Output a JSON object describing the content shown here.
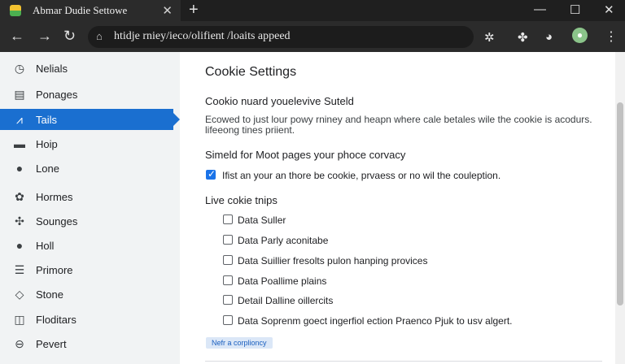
{
  "window": {
    "tab_title": "Abmar Dudie Settowe",
    "tab_close": "✕",
    "new_tab": "+",
    "minimize": "—",
    "maximize": "☐",
    "close": "✕"
  },
  "toolbar": {
    "back": "←",
    "forward": "→",
    "reload": "↻",
    "url": "htidje rniey/ieco/olifient /loaits appeed",
    "site_icon": "home-icon",
    "ext1": "✲",
    "ext2": "✤",
    "ext3": "◕",
    "avatar": "●",
    "menu": "⋮"
  },
  "sidebar": {
    "items": [
      {
        "label": "Nelials",
        "icon": "◷"
      },
      {
        "label": "Ponages",
        "icon": "▤"
      },
      {
        "label": "Tails",
        "icon": "⩘"
      },
      {
        "label": "Hoip",
        "icon": "▬"
      },
      {
        "label": "Lone",
        "icon": "●"
      },
      {
        "label": "Hormes",
        "icon": "✿"
      },
      {
        "label": "Sounges",
        "icon": "✣"
      },
      {
        "label": "Holl",
        "icon": "●"
      },
      {
        "label": "Primore",
        "icon": "☰"
      },
      {
        "label": "Stone",
        "icon": "◇"
      },
      {
        "label": "Floditars",
        "icon": "◫"
      },
      {
        "label": "Pevert",
        "icon": "⊖"
      }
    ],
    "active_index": 2
  },
  "main": {
    "title": "Cookie Settings",
    "section1_heading": "Cookio nuard youelevive Suteld",
    "section1_para": "Ecowed to just lour powy rniney and heapn where cale betales wile the cookie is acodurs. lifeeong tines priient.",
    "section2_heading": "Simeld for Moot pages your phoce corvacy",
    "main_checkbox_label": "Ifist an your an thore be cookie, prvaess or no wil the couleption.",
    "section3_heading": "Live cokie tnips",
    "options": [
      {
        "label": "Data Suller",
        "checked": false
      },
      {
        "label": "Data Parly aconitabe",
        "checked": false
      },
      {
        "label": "Data Suillier fresolts pulon hanping provices",
        "checked": false
      },
      {
        "label": "Data Poallime plains",
        "checked": false
      },
      {
        "label": "Detail Dalline oillercits",
        "checked": false
      },
      {
        "label": "Data Soprenm goect ingerfiol ection Praenco Pjuk to usv algert.",
        "checked": false
      }
    ],
    "button_label": "Nefr a corplioncy"
  }
}
